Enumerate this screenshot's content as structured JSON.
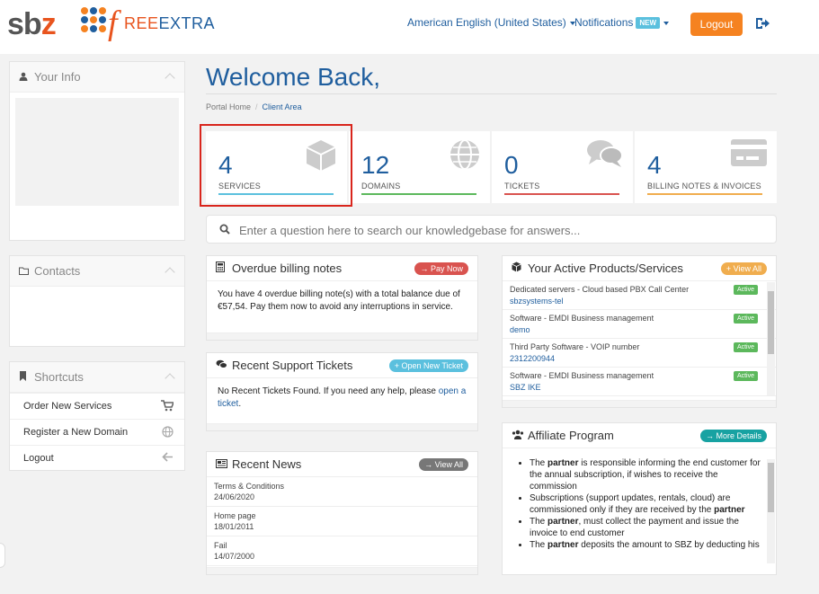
{
  "header": {
    "logo_sbz_prefix": "sb",
    "logo_sbz_z": "z",
    "logo_f": "f",
    "logo_free": "REE",
    "logo_extra": "EXTRA",
    "language": "American English (United States)",
    "notifications": "Notifications",
    "notifications_badge": "NEW",
    "logout": "Logout"
  },
  "sidebar": {
    "your_info": "Your Info",
    "contacts": "Contacts",
    "shortcuts": "Shortcuts",
    "shortcut_items": [
      {
        "label": "Order New Services",
        "icon": "cart-icon"
      },
      {
        "label": "Register a New Domain",
        "icon": "globe-icon"
      },
      {
        "label": "Logout",
        "icon": "arrow-left-icon"
      }
    ]
  },
  "main": {
    "welcome": "Welcome Back,",
    "breadcrumb": [
      "Portal Home",
      "Client Area"
    ],
    "stats": [
      {
        "number": "4",
        "label": "SERVICES",
        "color": "#5bc0de",
        "icon": "cube-icon"
      },
      {
        "number": "12",
        "label": "DOMAINS",
        "color": "#5cb85c",
        "icon": "globe-icon"
      },
      {
        "number": "0",
        "label": "TICKETS",
        "color": "#d9534f",
        "icon": "comments-icon"
      },
      {
        "number": "4",
        "label": "BILLING NOTES & INVOICES",
        "color": "#f0ad4e",
        "icon": "credit-card-icon"
      }
    ],
    "search_placeholder": "Enter a question here to search our knowledgebase for answers...",
    "overdue": {
      "title": "Overdue billing notes",
      "button": "→ Pay Now",
      "text": "You have 4 overdue billing note(s) with a total balance due of €57,54. Pay them now to avoid any interruptions in service."
    },
    "tickets": {
      "title": "Recent Support Tickets",
      "button": "+ Open New Ticket",
      "text": "No Recent Tickets Found. If you need any help, please ",
      "link": "open a ticket",
      "text_end": "."
    },
    "news": {
      "title": "Recent News",
      "button": "→ View All",
      "items": [
        {
          "title": "Terms & Conditions",
          "date": "24/06/2020"
        },
        {
          "title": "Home page",
          "date": "18/01/2011"
        },
        {
          "title": "Fail",
          "date": "14/07/2000"
        }
      ]
    },
    "products": {
      "title": "Your Active Products/Services",
      "button": "+ View All",
      "items": [
        {
          "name": "Dedicated servers - Cloud based PBX Call Center",
          "link": "sbzsystems-tel",
          "status": "Active"
        },
        {
          "name": "Software - EMDI Business management",
          "link": "demo",
          "status": "Active"
        },
        {
          "name": "Third Party Software - VOIP number",
          "link": "2312200944",
          "status": "Active"
        },
        {
          "name": "Software - EMDI Business management",
          "link": "SBZ IKE",
          "status": "Active"
        }
      ]
    },
    "affiliate": {
      "title": "Affiliate Program",
      "button": "→ More Details",
      "items": [
        {
          "pre": "The ",
          "bold": "partner",
          "post": " is responsible informing the end customer for the annual subscription, if wishes to receive the commission"
        },
        {
          "pre": "Subscriptions (support updates, rentals, cloud) are commissioned only if they are received by the ",
          "bold": "partner",
          "post": ""
        },
        {
          "pre": "The ",
          "bold": "partner",
          "post": ", must collect the payment and issue the invoice to end customer"
        },
        {
          "pre": "The ",
          "bold": "partner",
          "post": " deposits the amount to SBZ by deducting his"
        }
      ]
    }
  },
  "colors": {
    "brand_blue": "#1f5e9e",
    "brand_orange": "#f58220",
    "pay_now_red": "#d9534f",
    "info_blue": "#5bc0de",
    "more_details_teal": "#17a2a2",
    "view_all_gray": "#777777",
    "view_all_orange": "#f0ad4e",
    "active_green": "#5cb85c"
  }
}
